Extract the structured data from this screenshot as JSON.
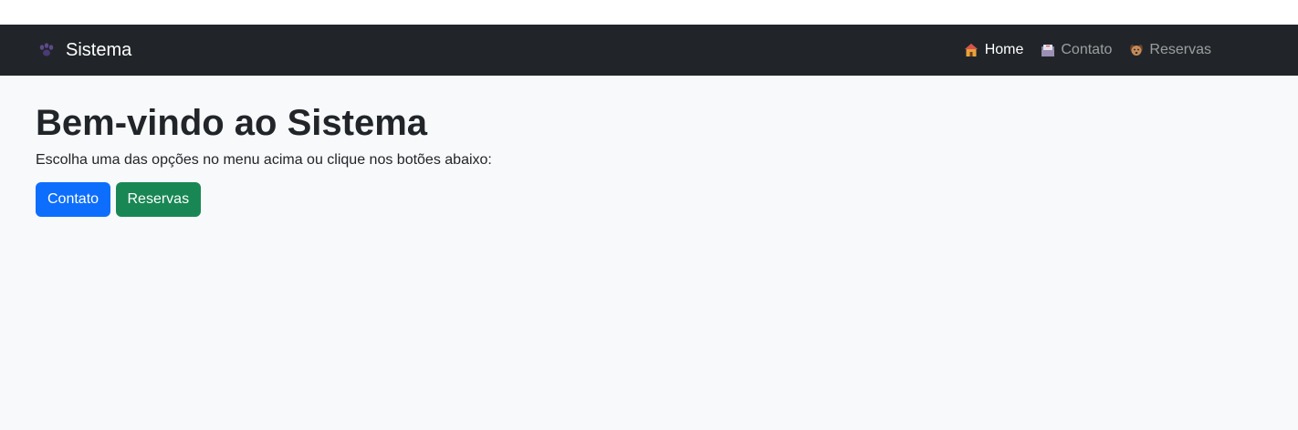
{
  "navbar": {
    "brand_icon": "paw-prints-icon",
    "brand_label": "Sistema",
    "items": [
      {
        "label": "Home",
        "icon": "house-icon",
        "active": true
      },
      {
        "label": "Contato",
        "icon": "inbox-icon",
        "active": false
      },
      {
        "label": "Reservas",
        "icon": "dog-icon",
        "active": false
      }
    ]
  },
  "main": {
    "title": "Bem-vindo ao Sistema",
    "subtitle": "Escolha uma das opções no menu acima ou clique nos botões abaixo:",
    "buttons": [
      {
        "label": "Contato",
        "color": "#0d6efd"
      },
      {
        "label": "Reservas",
        "color": "#198754"
      }
    ]
  },
  "colors": {
    "navbar_bg": "#212529",
    "page_bg": "#f8f9fa",
    "primary": "#0d6efd",
    "success": "#198754"
  }
}
